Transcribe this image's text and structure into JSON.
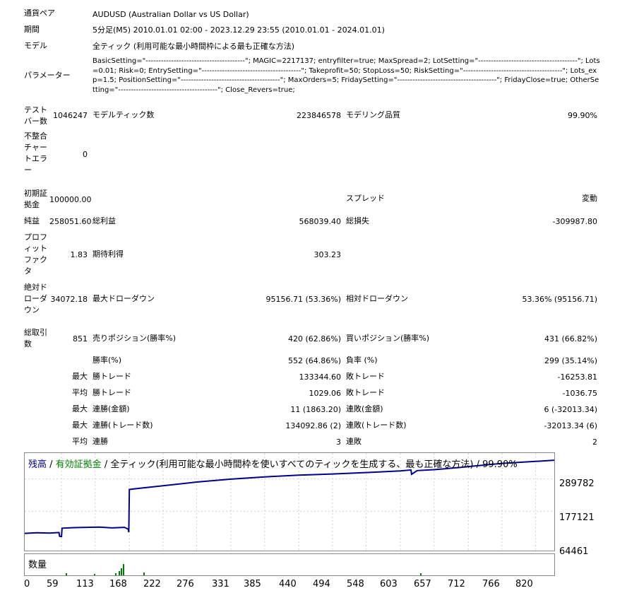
{
  "labels": {
    "symbol": "通貨ペア",
    "period": "期間",
    "model": "モデル",
    "params": "パラメーター",
    "bars": "テストバー数",
    "ticks": "モデルティック数",
    "quality": "モデリング品質",
    "mismatch": "不整合チャートエラー",
    "deposit": "初期証拠金",
    "spread": "スプレッド",
    "net": "純益",
    "gross_profit": "総利益",
    "gross_loss": "総損失",
    "pf": "プロフィットファクタ",
    "expected": "期待利得",
    "abs_dd": "絶対ドローダウン",
    "max_dd": "最大ドローダウン",
    "rel_dd": "相対ドローダウン",
    "total_trades": "総取引数",
    "short": "売りポジション(勝率%)",
    "long": "買いポジション(勝率%)",
    "win_rate": "勝率(%)",
    "loss_rate": "負率 (%)",
    "max": "最大",
    "avg": "平均",
    "win_trade": "勝トレード",
    "loss_trade": "敗トレード",
    "cons_win_amt": "連勝(金額)",
    "cons_loss_amt": "連敗(金額)",
    "cons_win_cnt": "連勝(トレード数)",
    "cons_loss_cnt": "連敗(トレード数)",
    "cons_win": "連勝",
    "cons_loss": "連敗"
  },
  "values": {
    "symbol": "AUDUSD (Australian Dollar vs US Dollar)",
    "period": "5分足(M5) 2010.01.01 02:00 - 2023.12.29 23:55 (2010.01.01 - 2024.01.01)",
    "model": "全ティック (利用可能な最小時間枠による最も正確な方法)",
    "params": "BasicSetting=\"---------------------------------------\"; MAGIC=2217137; entryfilter=true; MaxSpread=2; LotSetting=\"---------------------------------------\"; Lots=0.01; Risk=0; EntrySetting=\"---------------------------------------\"; Takeprofit=50; StopLoss=50; RiskSetting=\"---------------------------------------\"; Lots_exp=1.5; PositionSetting=\"---------------------------------------\"; MaxOrders=5; FridaySetting=\"---------------------------------------\"; FridayClose=true; OtherSetting=\"---------------------------------------\"; Close_Revers=true;",
    "bars": "1046247",
    "ticks": "223846578",
    "quality": "99.90%",
    "mismatch": "0",
    "deposit": "100000.00",
    "spread": "変動",
    "net": "258051.60",
    "gross_profit": "568039.40",
    "gross_loss": "-309987.80",
    "pf": "1.83",
    "expected": "303.23",
    "abs_dd": "34072.18",
    "max_dd": "95156.71 (53.36%)",
    "rel_dd": "53.36% (95156.71)",
    "total_trades": "851",
    "short": "420 (62.86%)",
    "long": "431 (66.82%)",
    "win_rate": "552 (64.86%)",
    "loss_rate": "299 (35.14%)",
    "max_win": "133344.60",
    "max_loss": "-16253.81",
    "avg_win": "1029.06",
    "avg_loss": "-1036.75",
    "cons_win_amt": "11 (1863.20)",
    "cons_loss_amt": "6 (-32013.34)",
    "cons_win_cnt": "134092.86 (2)",
    "cons_loss_cnt": "-32013.34 (6)",
    "avg_cons_win": "3",
    "avg_cons_loss": "2"
  },
  "chart": {
    "legend_balance": "残高",
    "legend_sep1": " / ",
    "legend_equity": "有効証拠金",
    "legend_rest": " / 全ティック(利用可能な最小時間枠を使いすべてのティックを生成する、最も正確な方法) / 99.90%",
    "volume_label": "数量",
    "balance_color": "#00008b",
    "equity_color": "#008000",
    "y_ticks": [
      "289782",
      "177121",
      "64461"
    ],
    "x_ticks": [
      "0",
      "59",
      "113",
      "168",
      "222",
      "276",
      "331",
      "385",
      "440",
      "494",
      "548",
      "603",
      "657",
      "712",
      "766",
      "820"
    ]
  },
  "chart_data": {
    "type": "line",
    "series": [
      {
        "name": "残高",
        "x": [
          0,
          20,
          40,
          55,
          56,
          59,
          60,
          80,
          100,
          120,
          140,
          160,
          166,
          167,
          168,
          180,
          222,
          276,
          331,
          385,
          440,
          494,
          548,
          603,
          620,
          621,
          630,
          657,
          700,
          712,
          766,
          820,
          850
        ],
        "y": [
          100000,
          102000,
          101000,
          103000,
          90000,
          89000,
          118000,
          120000,
          121000,
          122000,
          119000,
          121000,
          115000,
          104000,
          253000,
          256000,
          266000,
          279000,
          289000,
          297000,
          303000,
          307000,
          312000,
          318000,
          321000,
          306000,
          319000,
          322000,
          330000,
          333000,
          344000,
          351000,
          355000
        ]
      }
    ],
    "ylim": [
      40000,
      380000
    ],
    "xlim": [
      0,
      850
    ],
    "grid": true
  }
}
